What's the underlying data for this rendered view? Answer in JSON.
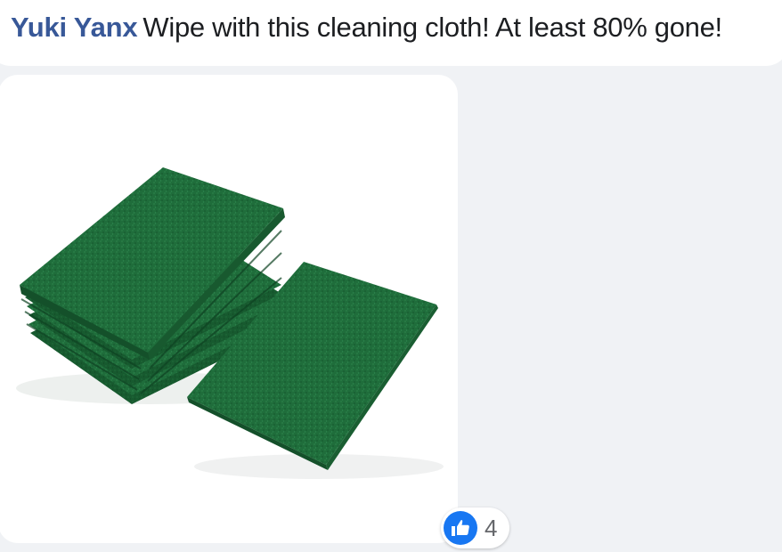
{
  "comment": {
    "author": "Yuki Yanx",
    "text": "Wipe with this cleaning cloth! At least 80% gone!"
  },
  "attachment": {
    "subject": "green-scouring-pads"
  },
  "reactions": {
    "icon": "like-icon",
    "count": "4",
    "accent_color": "#1877f2"
  },
  "colors": {
    "author_link": "#385898",
    "background": "#f0f2f5",
    "pad_green": "#1e6e3c"
  }
}
